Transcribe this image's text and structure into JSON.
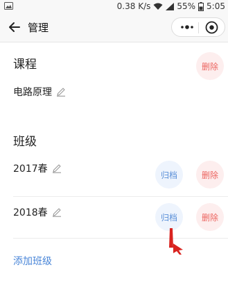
{
  "status_bar": {
    "speed": "0.38 K/s",
    "battery_percent": "55%",
    "time": "5:05"
  },
  "header": {
    "title": "管理"
  },
  "course_section": {
    "title": "课程",
    "course_name": "电路原理",
    "delete_label": "删除"
  },
  "class_section": {
    "title": "班级",
    "classes": [
      {
        "name": "2017春",
        "archive_label": "归档",
        "delete_label": "删除"
      },
      {
        "name": "2018春",
        "archive_label": "归档",
        "delete_label": "删除"
      }
    ],
    "add_class_label": "添加班级"
  },
  "colors": {
    "delete_text": "#ec6560",
    "delete_bg": "#fdeeee",
    "archive_text": "#5a8fd8",
    "archive_bg": "#eef4fd",
    "link": "#4a86d8"
  }
}
